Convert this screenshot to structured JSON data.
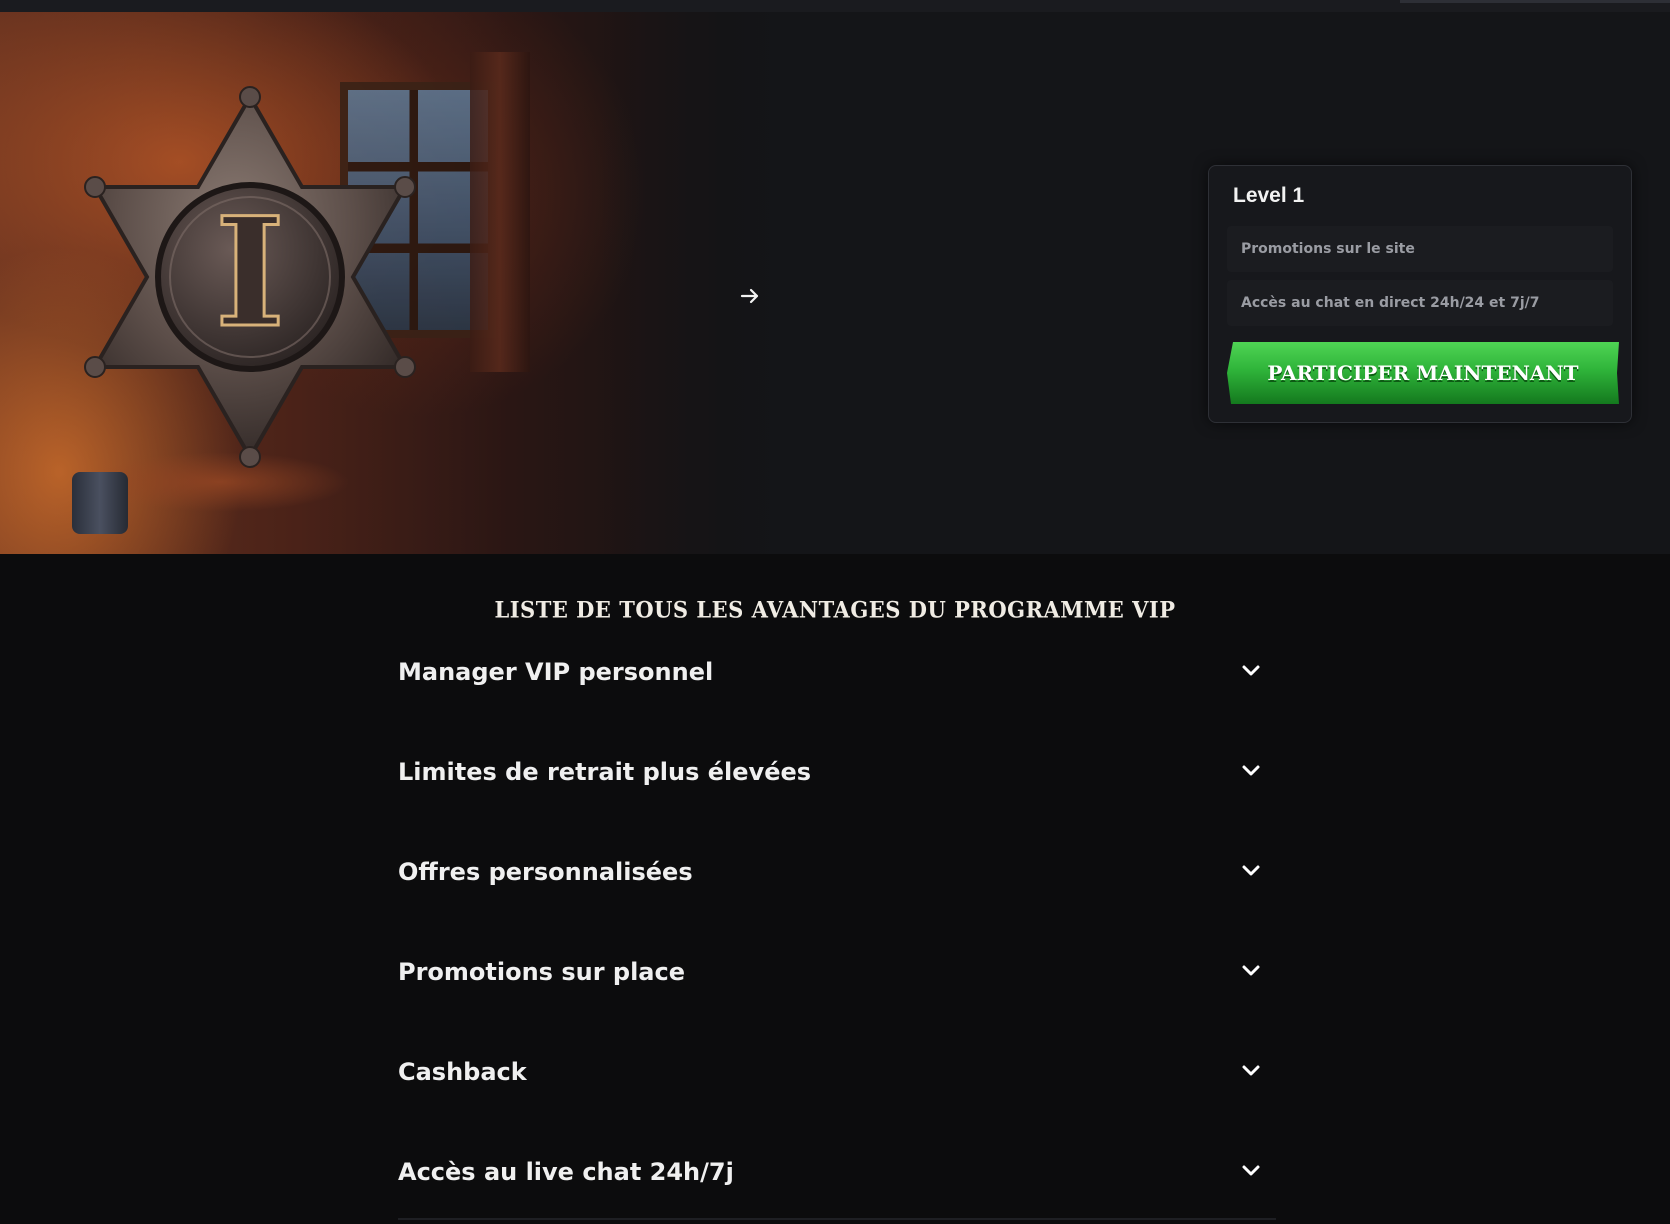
{
  "hero": {
    "next_arrow_icon": "arrow-right-icon",
    "badge_numeral": "I"
  },
  "level_card": {
    "title": "Level 1",
    "perks": [
      "Promotions sur le site",
      "Accès au chat en direct 24h/24 et 7j/7"
    ],
    "cta_label": "PARTICIPER MAINTENANT",
    "cta_color": "#2fb43a"
  },
  "benefits": {
    "title": "LISTE DE TOUS LES AVANTAGES DU PROGRAMME VIP",
    "items": [
      "Manager VIP personnel",
      "Limites de retrait plus élevées",
      "Offres personnalisées",
      "Promotions sur place",
      "Cashback",
      "Accès au live chat 24h/7j"
    ],
    "item_icon": "chevron-down-icon"
  }
}
